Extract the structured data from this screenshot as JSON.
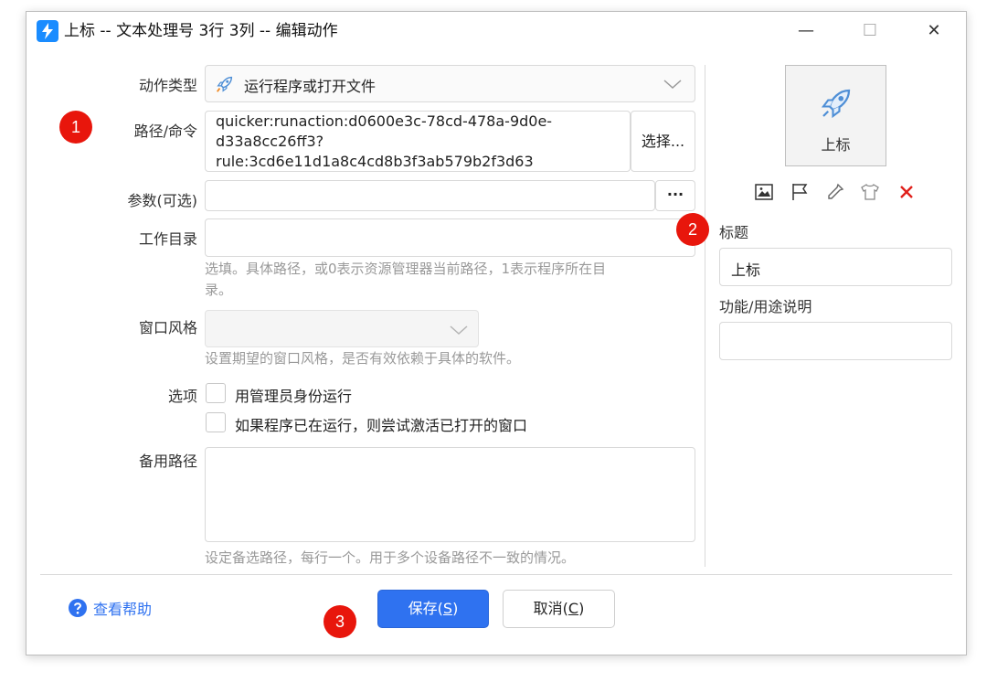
{
  "window": {
    "title": "上标 -- 文本处理号 3行 3列 -- 编辑动作",
    "minimize_glyph": "—",
    "maximize_glyph": "☐",
    "close_glyph": "✕"
  },
  "form": {
    "action_type_label": "动作类型",
    "action_type_value": "运行程序或打开文件",
    "path_label": "路径/命令",
    "path_lines": [
      "quicker:runaction:d0600e3c-78cd-478a-9d0e-",
      "d33a8cc26ff3?",
      "rule:3cd6e11d1a8c4cd8b3f3ab579b2f3d63"
    ],
    "choose_button": "选择...",
    "params_label": "参数(可选)",
    "params_more": "···",
    "workdir_label": "工作目录",
    "workdir_hint_1": "选填。具体路径，或0表示资源管理器当前路径，1表示程序所在目",
    "workdir_hint_2": "录。",
    "window_style_label": "窗口风格",
    "window_style_hint": "设置期望的窗口风格，是否有效依赖于具体的软件。",
    "options_label": "选项",
    "option_admin": "用管理员身份运行",
    "option_activate": "如果程序已在运行，则尝试激活已打开的窗口",
    "backup_path_label": "备用路径",
    "backup_path_hint": "设定备选路径，每行一个。用于多个设备路径不一致的情况。"
  },
  "side": {
    "preview_label": "上标",
    "title_label": "标题",
    "title_value": "上标",
    "desc_label": "功能/用途说明",
    "desc_value": ""
  },
  "footer": {
    "help_text": "查看帮助",
    "save_text": "保存(",
    "save_key": "S",
    "cancel_text": "取消(",
    "cancel_key": "C",
    "close_paren": ")"
  },
  "badges": [
    "1",
    "2",
    "3"
  ],
  "colors": {
    "accent": "#2f72f0",
    "badge": "#e8160c",
    "delete_icon": "#e0201b",
    "rocket": "#4f8fd6"
  }
}
